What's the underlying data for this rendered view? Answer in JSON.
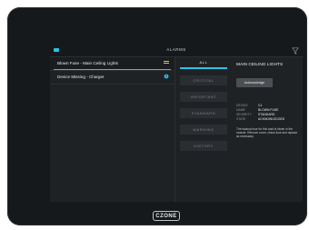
{
  "header": {
    "title": "ALARMS"
  },
  "alarms": [
    {
      "label": "Blown Fuse - Main Ceiling Lights",
      "status_icon": "warning-stripes-icon"
    },
    {
      "label": "Device Missing - Charger",
      "status_icon": "info-circle-icon"
    }
  ],
  "categories": [
    "ALL",
    "CRITICAL",
    "IMPORTANT",
    "STANDARD",
    "WARNING",
    "HISTORY"
  ],
  "detail": {
    "title": "MAIN CEILING LIGHTS",
    "acknowledge_label": "Acknowledge",
    "fields": [
      {
        "key": "DEVICE",
        "value": "C1"
      },
      {
        "key": "NAME",
        "value": "BLOWN FUSE"
      },
      {
        "key": "SEVERITY",
        "value": "STANDARD"
      },
      {
        "key": "STATE",
        "value": "ACKNOWLEDGED"
      }
    ],
    "description": "The backup fuse for this load is blown in the module. Remove cover, check fuse and replace as necessary."
  },
  "brand": {
    "logo_text": "CZONE"
  },
  "colors": {
    "accent": "#2ec1e6",
    "warning": "#e0c23b",
    "info": "#2ec1e6"
  }
}
